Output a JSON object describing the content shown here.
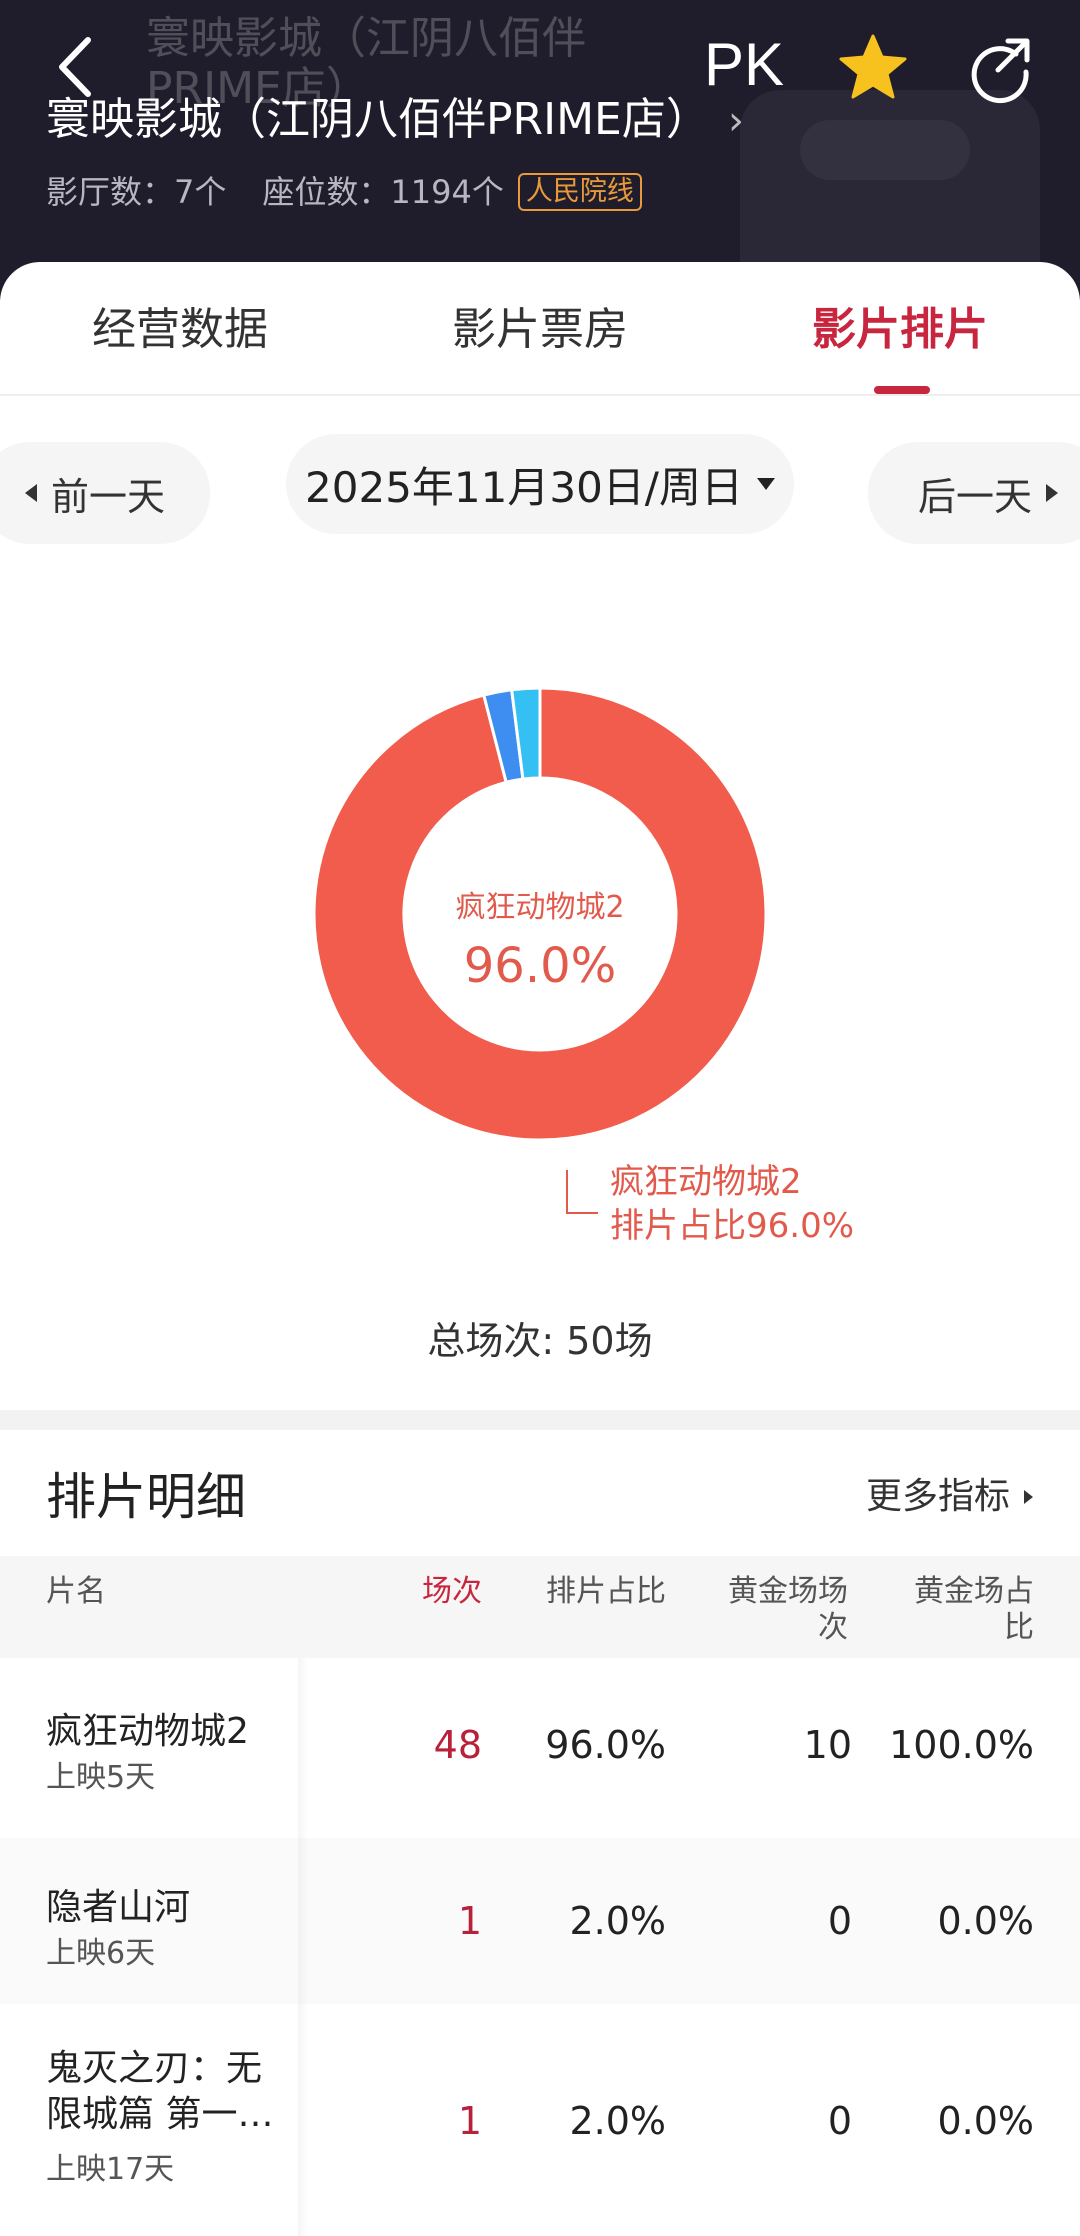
{
  "header": {
    "ghost_title": "寰映影城（江阴八佰伴PRIME店）",
    "pk_label": "PK",
    "cinema_name": "寰映影城（江阴八佰伴PRIME店）",
    "arrow": "›",
    "halls": "影厅数：7个",
    "seats": "座位数：1194个",
    "badge": "人民院线",
    "accent_color": "#c8263e"
  },
  "tabs": [
    {
      "label": "经营数据",
      "active": false
    },
    {
      "label": "影片票房",
      "active": false
    },
    {
      "label": "影片排片",
      "active": true
    }
  ],
  "date_nav": {
    "prev": "前一天",
    "date": "2025年11月30日/周日",
    "next": "后一天"
  },
  "chart_data": {
    "type": "pie",
    "donut": true,
    "center_label": "疯狂动物城2",
    "center_value": "96.0%",
    "callout_name": "疯狂动物城2",
    "callout_value": "排片占比96.0%",
    "slices": [
      {
        "label": "疯狂动物城2",
        "value": 96.0,
        "color": "#f25c4d"
      },
      {
        "label": "隐者山河",
        "value": 2.0,
        "color": "#3d8ef0"
      },
      {
        "label": "鬼灭之刃：无限城篇 第一…",
        "value": 2.0,
        "color": "#35c0f4"
      }
    ]
  },
  "total_label": "总场次: 50场",
  "detail": {
    "title": "排片明细",
    "more": "更多指标",
    "columns": [
      "片名",
      "场次",
      "排片占比",
      "黄金场场次",
      "黄金场占比"
    ],
    "rows": [
      {
        "name": "疯狂动物城2",
        "days": "上映5天",
        "sessions": "48",
        "share": "96.0%",
        "gold_sessions": "10",
        "gold_share": "100.0%"
      },
      {
        "name": "隐者山河",
        "days": "上映6天",
        "sessions": "1",
        "share": "2.0%",
        "gold_sessions": "0",
        "gold_share": "0.0%"
      },
      {
        "name": "鬼灭之刃：无限城篇 第一…",
        "days": "上映17天",
        "sessions": "1",
        "share": "2.0%",
        "gold_sessions": "0",
        "gold_share": "0.0%"
      }
    ]
  }
}
